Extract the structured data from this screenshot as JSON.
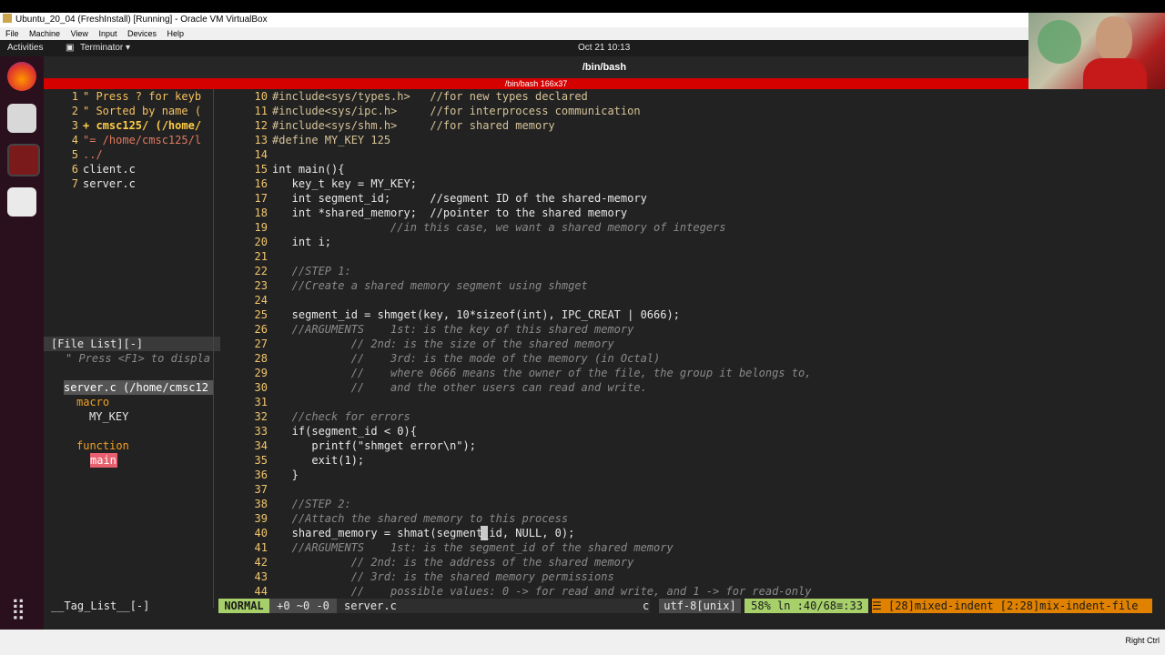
{
  "vbox": {
    "title": "Ubuntu_20_04 (FreshInstall) [Running] - Oracle VM VirtualBox",
    "menu": [
      "File",
      "Machine",
      "View",
      "Input",
      "Devices",
      "Help"
    ],
    "right_ctrl": "Right Ctrl"
  },
  "gnome": {
    "activities": "Activities",
    "app_menu": "Terminator ▾",
    "clock": "Oct 21  10:13"
  },
  "terminal": {
    "title": "/bin/bash",
    "subtitle": "/bin/bash 166x37"
  },
  "explorer": [
    {
      "n": "1",
      "t": "\" Press ? for keyb"
    },
    {
      "n": "2",
      "t": "\" Sorted by name ("
    },
    {
      "n": "3",
      "t": "+ cmsc125/ (/home/"
    },
    {
      "n": "4",
      "t": "\"= /home/cmsc125/l"
    },
    {
      "n": "5",
      "t": "../"
    },
    {
      "n": "6",
      "t": "client.c"
    },
    {
      "n": "7",
      "t": "server.c"
    }
  ],
  "taglist": {
    "header": "[File List][-]",
    "hint": "\" Press <F1> to displa",
    "file": "server.c (/home/cmsc12",
    "macro_label": "macro",
    "macro_item": "MY_KEY",
    "function_label": "function",
    "function_item": "main"
  },
  "code_lines": [
    {
      "n": "10",
      "t": "#include<sys/types.h>   //for new types declared"
    },
    {
      "n": "11",
      "t": "#include<sys/ipc.h>     //for interprocess communication"
    },
    {
      "n": "12",
      "t": "#include<sys/shm.h>     //for shared memory"
    },
    {
      "n": "13",
      "t": "#define MY_KEY 125"
    },
    {
      "n": "14",
      "t": ""
    },
    {
      "n": "15",
      "t": "int main(){"
    },
    {
      "n": "16",
      "t": "   key_t key = MY_KEY;"
    },
    {
      "n": "17",
      "t": "   int segment_id;      //segment ID of the shared-memory"
    },
    {
      "n": "18",
      "t": "   int *shared_memory;  //pointer to the shared memory"
    },
    {
      "n": "19",
      "t": "                  //in this case, we want a shared memory of integers"
    },
    {
      "n": "20",
      "t": "   int i;"
    },
    {
      "n": "21",
      "t": ""
    },
    {
      "n": "22",
      "t": "   //STEP 1:"
    },
    {
      "n": "23",
      "t": "   //Create a shared memory segment using shmget"
    },
    {
      "n": "24",
      "t": ""
    },
    {
      "n": "25",
      "t": "   segment_id = shmget(key, 10*sizeof(int), IPC_CREAT | 0666);"
    },
    {
      "n": "26",
      "t": "   //ARGUMENTS    1st: is the key of this shared memory"
    },
    {
      "n": "27",
      "t": "            // 2nd: is the size of the shared memory"
    },
    {
      "n": "28",
      "t": "            //    3rd: is the mode of the memory (in Octal)"
    },
    {
      "n": "29",
      "t": "            //    where 0666 means the owner of the file, the group it belongs to,"
    },
    {
      "n": "30",
      "t": "            //    and the other users can read and write."
    },
    {
      "n": "31",
      "t": ""
    },
    {
      "n": "32",
      "t": "   //check for errors"
    },
    {
      "n": "33",
      "t": "   if(segment_id < 0){"
    },
    {
      "n": "34",
      "t": "      printf(\"shmget error\\n\");"
    },
    {
      "n": "35",
      "t": "      exit(1);"
    },
    {
      "n": "36",
      "t": "   }"
    },
    {
      "n": "37",
      "t": ""
    },
    {
      "n": "38",
      "t": "   //STEP 2:"
    },
    {
      "n": "39",
      "t": "   //Attach the shared memory to this process"
    },
    {
      "n": "40",
      "t": "   shared_memory = shmat(segment_id, NULL, 0);"
    },
    {
      "n": "41",
      "t": "   //ARGUMENTS    1st: is the segment_id of the shared memory"
    },
    {
      "n": "42",
      "t": "            // 2nd: is the address of the shared memory"
    },
    {
      "n": "43",
      "t": "            // 3rd: is the shared memory permissions"
    },
    {
      "n": "44",
      "t": "            //    possible values: 0 -> for read and write, and 1 -> for read-only"
    }
  ],
  "status": {
    "taglist": "__Tag_List__[-]",
    "mode": "NORMAL",
    "git": "+0 ~0 -0",
    "file": "server.c",
    "ft": "c",
    "enc": "utf-8[unix]",
    "pct": "58%",
    "pos": "ln :40/68≡:33",
    "warn": "☰ [28]mixed-indent [2:28]mix-indent-file"
  },
  "colors": {
    "normal_mode": "#a7d06b",
    "warning": "#e08200",
    "accent_red": "#d50000"
  }
}
